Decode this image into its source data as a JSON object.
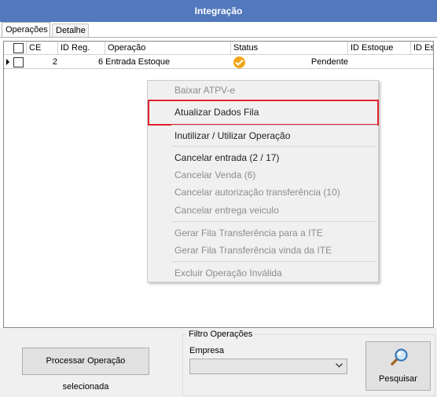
{
  "window": {
    "title": "Integração"
  },
  "tabs": [
    {
      "label": "Operações",
      "active": true
    },
    {
      "label": "Detalhe",
      "active": false
    }
  ],
  "grid": {
    "columns": [
      "CE",
      "ID Reg.",
      "Operação",
      "Status",
      "ID Estoque",
      "ID Es"
    ],
    "rows": [
      {
        "ce_checked": false,
        "id_reg": "2",
        "operacao": "6 Entrada Estoque",
        "status_icon": "check-circle-icon",
        "status": "Pendente",
        "id_estoque": ""
      }
    ]
  },
  "context_menu": {
    "items": [
      {
        "label": "Baixar ATPV-e",
        "enabled": false
      },
      {
        "label": "Atualizar Dados Fila",
        "enabled": true,
        "highlighted": true
      },
      {
        "label": "Inutilizar / Utilizar Operação",
        "enabled": true
      },
      {
        "label": "Cancelar entrada (2 / 17)",
        "enabled": true
      },
      {
        "label": "Cancelar Venda (6)",
        "enabled": false
      },
      {
        "label": "Cancelar autorização transferência (10)",
        "enabled": false
      },
      {
        "label": "Cancelar entrega veiculo",
        "enabled": false
      },
      {
        "label": "Gerar Fila Transferência para a ITE",
        "enabled": false
      },
      {
        "label": "Gerar Fila Transferência vinda da ITE",
        "enabled": false
      },
      {
        "label": "Excluir Operação Inválida",
        "enabled": false
      }
    ]
  },
  "bottom": {
    "process_button": "Processar Operação selecionada",
    "filter_group_title": "Filtro Operações",
    "empresa_label": "Empresa",
    "empresa_value": "",
    "search_button": "Pesquisar"
  },
  "colors": {
    "title_bar": "#5279bd",
    "highlight_border": "#e0212c",
    "status_icon": "#f2a416",
    "panel_bg": "#f0f0f0"
  }
}
